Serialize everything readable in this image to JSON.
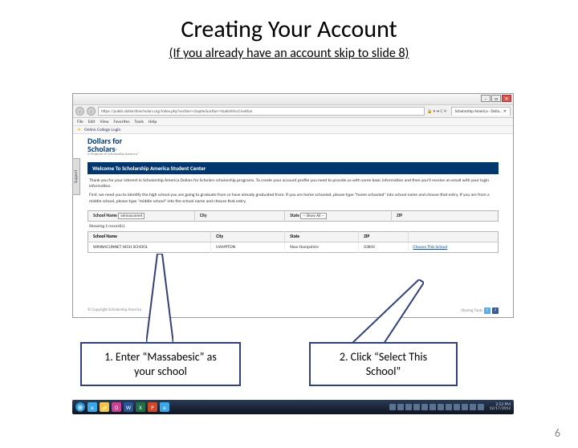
{
  "slide": {
    "title": "Creating Your Account",
    "subtitle": "(If you already have an account skip to slide 8)",
    "page_number": "6"
  },
  "callouts": {
    "one": "1.  Enter “Massabesic” as your school",
    "two": "2.  Click “Select This School”"
  },
  "browser": {
    "back_icon": "‹",
    "fwd_icon": "›",
    "address": "https://public.dollarsforscholars.org/index.php?section=chapter&action=studentAccCreation",
    "addr_controls": "🔒  ▾  ➔  C  ✕",
    "tab_title": "Scholarship America - Dolla... ✕",
    "win_min": "–",
    "win_max": "□",
    "win_close": "✕",
    "menu": {
      "file": "File",
      "edit": "Edit",
      "view": "View",
      "favorites": "Favorites",
      "tools": "Tools",
      "help": "Help"
    },
    "toolbar": {
      "star": "★",
      "link": "Online College Login"
    }
  },
  "page": {
    "support_tab": "Support",
    "logo_main": "Dollars for",
    "logo_main2": "Scholars",
    "logo_reg": "®",
    "logo_sub": "A Program of Scholarship America®",
    "welcome": "Welcome To Scholarship America Student Center",
    "intro1": "Thank you for your interest in Scholarship America Dollars for Scholars scholarship programs. To create your account profile you need to provide us with some basic information and then you'll receive an email with your login information.",
    "intro2": "First, we need you to identify the high school you are going to graduate from or have already graduated from. If you are home schooled, please type \"home schooled\" into school name and choose that entry. If you are from a middle school, please type \"middle school\" into the school name and choose that entry.",
    "search": {
      "col_school": "School Name",
      "col_city": "City",
      "col_state": "State",
      "col_zip": "ZIP",
      "school_value": "winnacunnet",
      "state_value": "-- Show All --"
    },
    "showing": "Showing 1 record(s).",
    "results": {
      "col_school": "School Name",
      "col_city": "City",
      "col_state": "State",
      "col_zip": "ZIP",
      "row": {
        "school": "WINNACUNNET HIGH SCHOOL",
        "city": "HAMPTON",
        "state": "New Hampshire",
        "zip": "03842",
        "choose": "Choose This School"
      }
    },
    "copyright": "© Copyright Scholarship America",
    "social_label": "Sharing Tools",
    "tw": "t",
    "fb": "f"
  },
  "taskbar": {
    "start": "⊞",
    "ie": "e",
    "folder": "📁",
    "oc": "O",
    "word": "W",
    "excel": "X",
    "ppt": "P",
    "ie2": "e",
    "time": "2:52 PM",
    "date": "12/17/2012"
  }
}
